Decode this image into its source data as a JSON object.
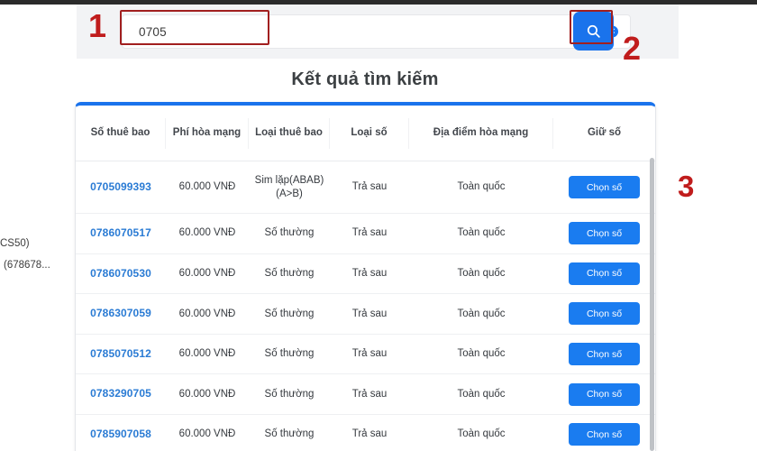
{
  "search": {
    "value": "0705",
    "placeholder": "",
    "clear_icon": "clear-circle-icon",
    "search_icon": "search-icon"
  },
  "annotations": [
    {
      "label": "1",
      "target": "search-input"
    },
    {
      "label": "2",
      "target": "search-button"
    },
    {
      "label": "3",
      "target": "first-row-choose-button"
    }
  ],
  "edge_fragments": {
    "line1": "CS50)",
    "line2": "(678678..."
  },
  "page": {
    "title": "Kết quả tìm kiếm"
  },
  "table": {
    "headers": [
      "Số thuê bao",
      "Phí hòa mạng",
      "Loại thuê bao",
      "Loại số",
      "Địa điểm hòa mạng",
      "Giữ số"
    ],
    "action_label": "Chọn số",
    "rows": [
      {
        "number": "0705099393",
        "fee": "60.000 VNĐ",
        "sub_type": "Sim lặp(ABAB) (A>B)",
        "number_type": "Trả sau",
        "location": "Toàn quốc",
        "action": "Chọn số"
      },
      {
        "number": "0786070517",
        "fee": "60.000 VNĐ",
        "sub_type": "Số thường",
        "number_type": "Trả sau",
        "location": "Toàn quốc",
        "action": "Chọn số"
      },
      {
        "number": "0786070530",
        "fee": "60.000 VNĐ",
        "sub_type": "Số thường",
        "number_type": "Trả sau",
        "location": "Toàn quốc",
        "action": "Chọn số"
      },
      {
        "number": "0786307059",
        "fee": "60.000 VNĐ",
        "sub_type": "Số thường",
        "number_type": "Trả sau",
        "location": "Toàn quốc",
        "action": "Chọn số"
      },
      {
        "number": "0785070512",
        "fee": "60.000 VNĐ",
        "sub_type": "Số thường",
        "number_type": "Trả sau",
        "location": "Toàn quốc",
        "action": "Chọn số"
      },
      {
        "number": "0783290705",
        "fee": "60.000 VNĐ",
        "sub_type": "Số thường",
        "number_type": "Trả sau",
        "location": "Toàn quốc",
        "action": "Chọn số"
      },
      {
        "number": "0785907058",
        "fee": "60.000 VNĐ",
        "sub_type": "Số thường",
        "number_type": "Trả sau",
        "location": "Toàn quốc",
        "action": "Chọn số"
      }
    ]
  },
  "colors": {
    "accent_blue": "#1a73ec",
    "link_blue": "#2a7bd4",
    "annotation_red": "#c01c1c",
    "title_gray": "#3c4043"
  }
}
